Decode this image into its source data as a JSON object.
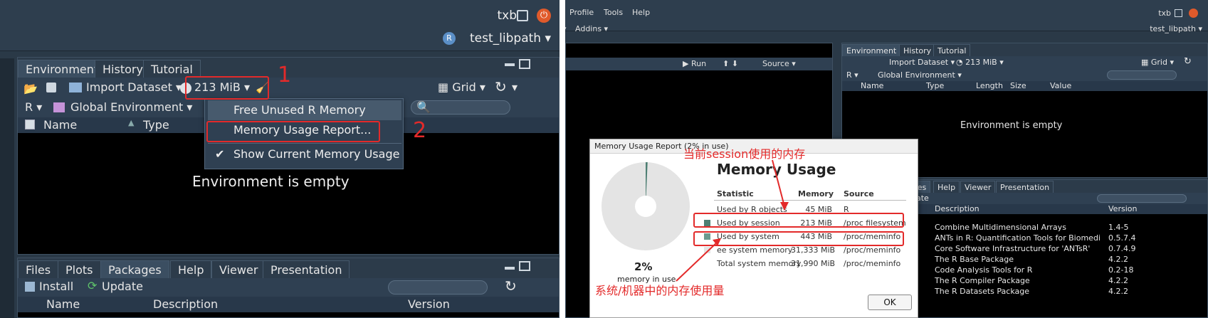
{
  "left": {
    "user": "txb",
    "project": "test_libpath",
    "env_tabs": [
      "Environment",
      "History",
      "Tutorial"
    ],
    "toolbar": {
      "import_dataset": "Import Dataset",
      "memory": "213 MiB",
      "grid": "Grid"
    },
    "r_label": "R",
    "global_env": "Global Environment",
    "columns": {
      "name": "Name",
      "type": "Type"
    },
    "empty_message": "Environment is empty",
    "memory_menu": [
      "Free Unused R Memory",
      "Memory Usage Report...",
      "Show Current Memory Usage"
    ],
    "files_tabs": [
      "Files",
      "Plots",
      "Packages",
      "Help",
      "Viewer",
      "Presentation"
    ],
    "files_toolbar": {
      "install": "Install",
      "update": "Update"
    },
    "pkg_columns": {
      "name": "Name",
      "description": "Description",
      "version": "Version"
    },
    "annotations": {
      "step1": "1",
      "step2": "2"
    },
    "colors": {
      "highlight": "#e32a2a",
      "accent_power": "#e05a2b"
    }
  },
  "right": {
    "menus": [
      "Profile",
      "Tools",
      "Help"
    ],
    "addins": "Addins",
    "user": "txb",
    "project": "test_libpath",
    "source_toolbar": {
      "run": "Run",
      "source": "Source"
    },
    "env_tabs": [
      "Environment",
      "History",
      "Tutorial"
    ],
    "env_toolbar": {
      "import_dataset": "Import Dataset",
      "memory": "213 MiB",
      "grid": "Grid"
    },
    "r_label": "R",
    "global_env": "Global Environment",
    "env_columns": [
      "Name",
      "Type",
      "Length",
      "Size",
      "Value"
    ],
    "empty_message": "Environment is empty",
    "pkg_tabs": [
      "ages",
      "Help",
      "Viewer",
      "Presentation"
    ],
    "pkg_update_fragment": "ate",
    "pkg_columns": {
      "description": "Description",
      "version": "Version"
    },
    "packages": [
      {
        "description": "Combine Multidimensional Arrays",
        "version": "1.4-5"
      },
      {
        "description": "ANTs in R: Quantification Tools for Biomedical Images",
        "version": "0.5.7.4"
      },
      {
        "description": "Core Software Infrastructure for 'ANTsR'",
        "version": "0.7.4.9"
      },
      {
        "description": "The R Base Package",
        "version": "4.2.2"
      },
      {
        "description": "Code Analysis Tools for R",
        "version": "0.2-18"
      },
      {
        "description": "The R Compiler Package",
        "version": "4.2.2"
      },
      {
        "description": "The R Datasets Package",
        "version": "4.2.2"
      }
    ],
    "dialog": {
      "title": "Memory Usage Report (2% in use)",
      "heading": "Memory Usage",
      "percent": "2%",
      "percent_caption": "memory in use",
      "percent_value": 0.02,
      "session_fraction": 0.007,
      "columns": [
        "Statistic",
        "Memory",
        "Source"
      ],
      "rows": [
        {
          "stat": "Used by R objects",
          "memory": "45 MiB",
          "source": "R",
          "swatch": ""
        },
        {
          "stat": "Used by session",
          "memory": "213 MiB",
          "source": "/proc filesystem",
          "swatch": "#4d7f73"
        },
        {
          "stat": "Used by system",
          "memory": "443 MiB",
          "source": "/proc/meminfo",
          "swatch": "#6b9a8f"
        },
        {
          "stat": "ee system memory",
          "memory": "31,333 MiB",
          "source": "/proc/meminfo",
          "swatch": "#e4e4e4"
        },
        {
          "stat": "Total system memory",
          "memory": "31,990 MiB",
          "source": "/proc/meminfo",
          "swatch": ""
        }
      ],
      "ok": "OK"
    },
    "annotations": {
      "session_note": "当前session使用的内存",
      "system_note": "系统/机器中的内存使用量"
    }
  }
}
